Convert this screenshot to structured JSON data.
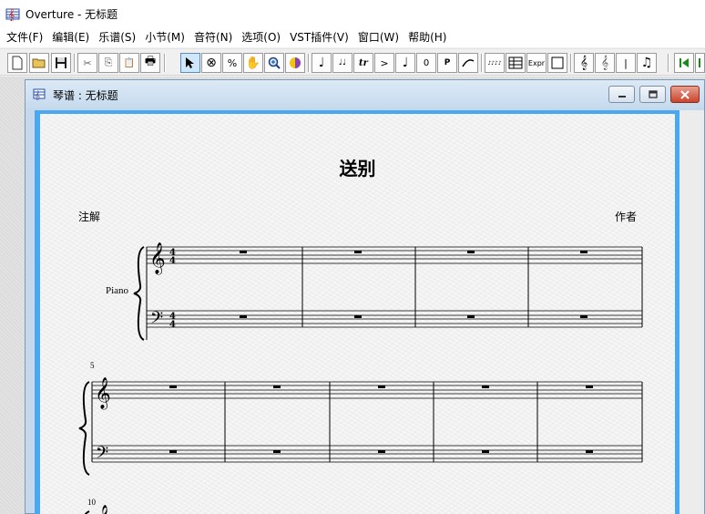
{
  "window": {
    "title": "Overture - 无标题",
    "app_icon": "overture-app-icon"
  },
  "menu": [
    "文件(F)",
    "编辑(E)",
    "乐谱(S)",
    "小节(M)",
    "音符(N)",
    "选项(O)",
    "VST插件(V)",
    "窗口(W)",
    "帮助(H)"
  ],
  "toolbar": {
    "buttons": [
      {
        "name": "new-doc",
        "glyph": ""
      },
      {
        "name": "open",
        "glyph": ""
      },
      {
        "name": "save",
        "glyph": ""
      },
      {
        "name": "cut",
        "glyph": "✂"
      },
      {
        "name": "copy",
        "glyph": "⎘"
      },
      {
        "name": "paste",
        "glyph": "📋"
      },
      {
        "name": "print",
        "glyph": "🖶"
      },
      {
        "name": "select-tool",
        "glyph": ""
      },
      {
        "name": "erase-tool",
        "glyph": "⊗"
      },
      {
        "name": "percent-tool",
        "glyph": "%"
      },
      {
        "name": "hand-tool",
        "glyph": "✋"
      },
      {
        "name": "zoom-tool",
        "glyph": ""
      },
      {
        "name": "color-tool",
        "glyph": "◐"
      },
      {
        "name": "quarter-note",
        "glyph": "♩"
      },
      {
        "name": "tie",
        "glyph": "♩♩"
      },
      {
        "name": "trill",
        "glyph": "tr"
      },
      {
        "name": "accent",
        "glyph": ">"
      },
      {
        "name": "note",
        "glyph": "♩"
      },
      {
        "name": "zero",
        "glyph": "0"
      },
      {
        "name": "piano-dynamic",
        "glyph": "P"
      },
      {
        "name": "slur",
        "glyph": ""
      },
      {
        "name": "tempo-marks",
        "glyph": "♪♪♪♪"
      },
      {
        "name": "lyrics",
        "glyph": ""
      },
      {
        "name": "expression",
        "glyph": "Expr"
      },
      {
        "name": "box",
        "glyph": ""
      },
      {
        "name": "treble-clef",
        "glyph": "𝄞"
      },
      {
        "name": "clef-alt",
        "glyph": "𝄞"
      },
      {
        "name": "barline",
        "glyph": "|"
      },
      {
        "name": "notes-pair",
        "glyph": "♫"
      },
      {
        "name": "rewind",
        "glyph": ""
      },
      {
        "name": "play-start",
        "glyph": ""
      }
    ]
  },
  "child_window": {
    "title": "琴谱 : 无标题"
  },
  "score": {
    "title": "送别",
    "annotation": "注解",
    "composer": "作者",
    "instrument": "Piano",
    "time_signature": "4/4",
    "system_measure_numbers": [
      "5",
      "10"
    ]
  },
  "colors": {
    "accent": "#4aa8f0",
    "child_border": "#7a9ab8",
    "close_button": "#c9442c"
  }
}
